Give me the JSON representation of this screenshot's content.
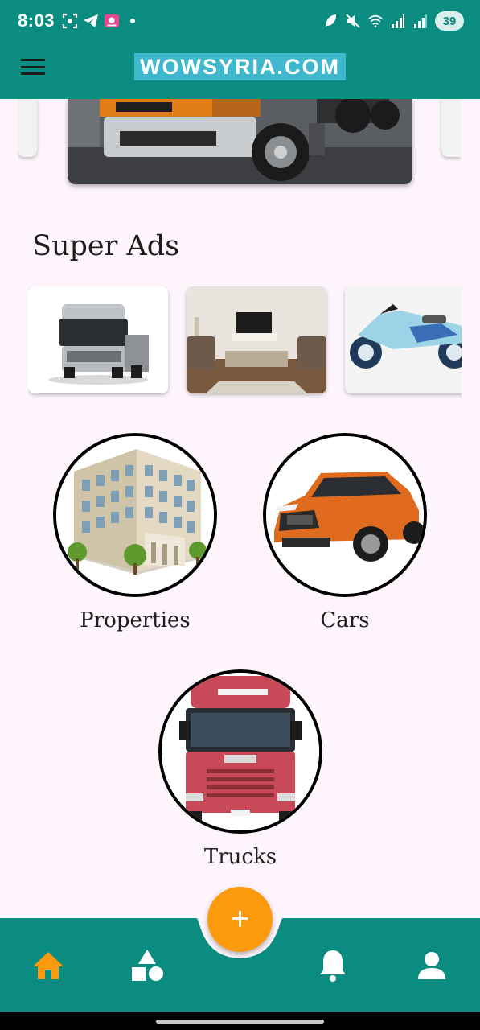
{
  "status_bar": {
    "time": "8:03",
    "battery": "39",
    "left_icons": [
      "screenshot-icon",
      "telegram-icon",
      "app-notification-icon",
      "dot-icon"
    ],
    "right_icons": [
      "leaf-icon",
      "mute-icon",
      "wifi-icon",
      "signal-icon",
      "signal-icon"
    ]
  },
  "app_bar": {
    "brand": "WOWSYRIA.COM",
    "menu_icon": "hamburger-menu-icon"
  },
  "colors": {
    "primary": "#0b8c80",
    "accent": "#fb9a0c",
    "brand_bg": "#3fb8cd",
    "background": "#fdf5fb"
  },
  "super_ads": {
    "title": "Super Ads",
    "items": [
      "truck-image",
      "living-room-image",
      "motorcycle-image"
    ]
  },
  "categories": [
    {
      "label": "Properties",
      "image": "building-image"
    },
    {
      "label": "Cars",
      "image": "orange-suv-image"
    },
    {
      "label": "Trucks",
      "image": "red-truck-image"
    }
  ],
  "bottom_nav": {
    "fab_icon": "plus-icon",
    "fab_symbol": "+",
    "items": [
      "home-icon",
      "categories-shapes-icon",
      "notifications-bell-icon",
      "profile-person-icon"
    ],
    "active": "home-icon"
  }
}
